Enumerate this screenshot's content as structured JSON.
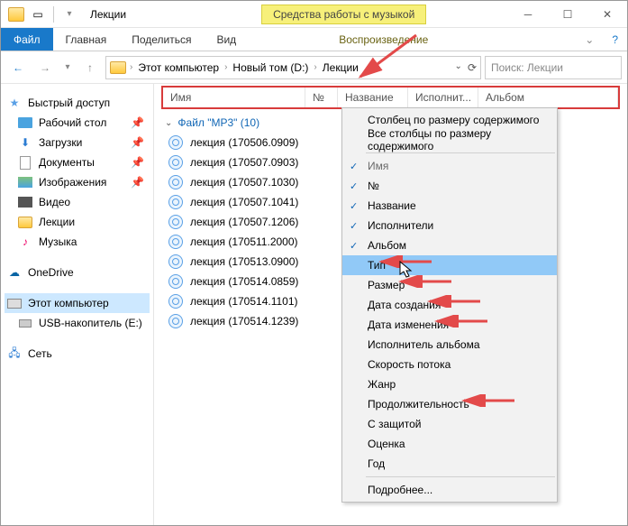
{
  "window": {
    "title": "Лекции"
  },
  "context_tool": "Средства работы с музыкой",
  "ribbon": {
    "file": "Файл",
    "tabs": [
      "Главная",
      "Поделиться",
      "Вид"
    ],
    "context_tab": "Воспроизведение"
  },
  "breadcrumbs": [
    "Этот компьютер",
    "Новый том (D:)",
    "Лекции"
  ],
  "search": {
    "placeholder": "Поиск: Лекции"
  },
  "sidebar": {
    "quick": {
      "label": "Быстрый доступ",
      "items": [
        {
          "label": "Рабочий стол"
        },
        {
          "label": "Загрузки"
        },
        {
          "label": "Документы"
        },
        {
          "label": "Изображения"
        },
        {
          "label": "Видео"
        },
        {
          "label": "Лекции"
        },
        {
          "label": "Музыка"
        }
      ]
    },
    "onedrive": "OneDrive",
    "thispc": "Этот компьютер",
    "usb": "USB-накопитель (E:)",
    "network": "Сеть"
  },
  "columns": {
    "name": "Имя",
    "num": "№",
    "title": "Название",
    "artist": "Исполнит...",
    "album": "Альбом"
  },
  "group": {
    "label": "Файл \"MP3\" (10)"
  },
  "files": [
    "лекция (170506.0909)",
    "лекция (170507.0903)",
    "лекция (170507.1030)",
    "лекция (170507.1041)",
    "лекция (170507.1206)",
    "лекция (170511.2000)",
    "лекция (170513.0900)",
    "лекция (170514.0859)",
    "лекция (170514.1101)",
    "лекция (170514.1239)"
  ],
  "context_menu": {
    "autosize": "Столбец по размеру содержимого",
    "autosize_all": "Все столбцы по размеру содержимого",
    "checked": [
      "Имя",
      "№",
      "Название",
      "Исполнители",
      "Альбом"
    ],
    "unchecked": [
      "Тип",
      "Размер",
      "Дата создания",
      "Дата изменения",
      "Исполнитель альбома",
      "Скорость потока",
      "Жанр",
      "Продолжительность",
      "С защитой",
      "Оценка",
      "Год"
    ],
    "more": "Подробнее..."
  }
}
